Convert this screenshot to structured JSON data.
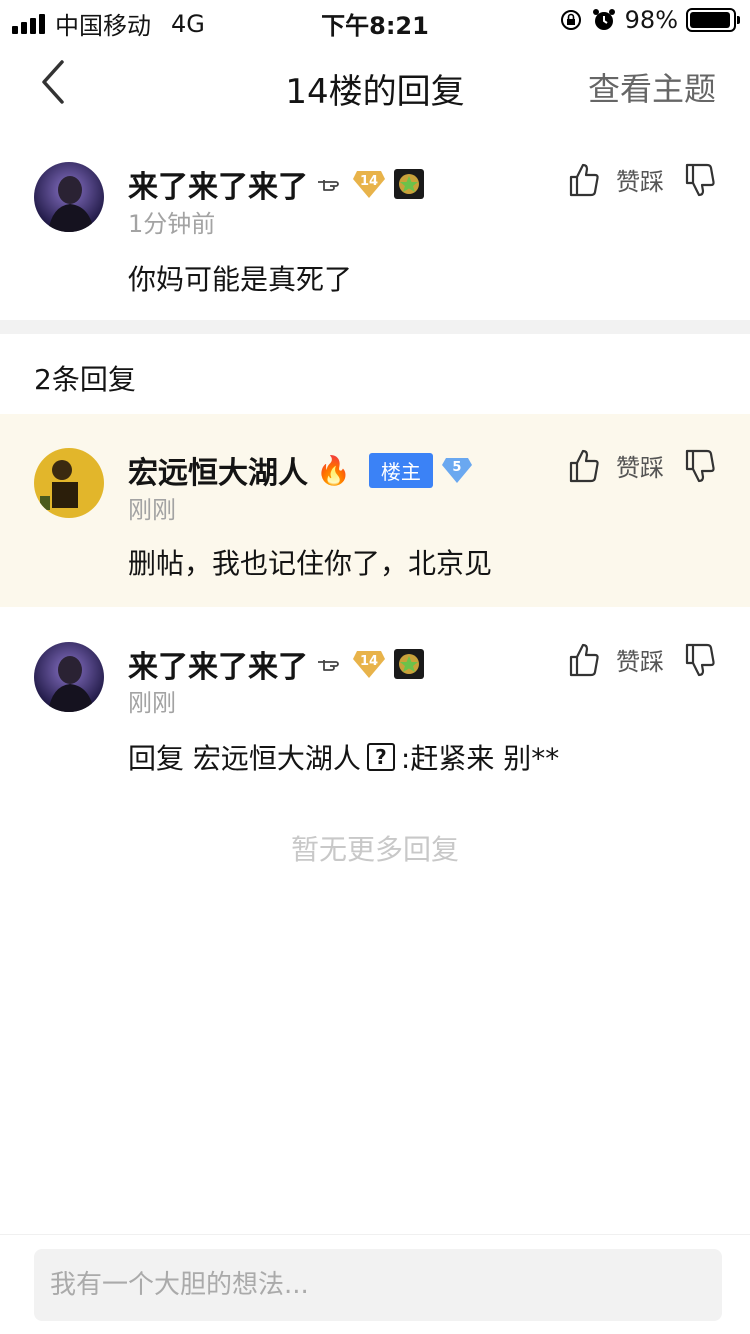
{
  "status_bar": {
    "carrier": "中国移动",
    "network": "4G",
    "time": "下午8:21",
    "battery": "98%",
    "battery_level": 0.98
  },
  "nav": {
    "title": "14楼的回复",
    "view_topic": "查看主题"
  },
  "main_post": {
    "username": "来了来了来了",
    "username_icon": "pointing-hand-icon",
    "level": "14",
    "time": "1分钟前",
    "content": "你妈可能是真死了",
    "like_icon": "thumbs-up-icon",
    "action_label": "赞踩",
    "dislike_icon": "thumbs-down-icon"
  },
  "reply_count": "2条回复",
  "replies": [
    {
      "username": "宏远恒大湖人",
      "emoji": "🔥",
      "badge": "楼主",
      "level": "5",
      "time": "刚刚",
      "content": "删帖，我也记住你了，北京见",
      "action_label": "赞踩"
    },
    {
      "username": "来了来了来了",
      "level": "14",
      "time": "刚刚",
      "content_prefix": "回复 宏远恒大湖人",
      "content_box_glyph": "?",
      "content_suffix": ":赶紧来 别**",
      "action_label": "赞踩"
    }
  ],
  "no_more": "暂无更多回复",
  "input": {
    "placeholder": "我有一个大胆的想法..."
  },
  "colors": {
    "owner_badge": "#3b82f6",
    "highlight_bg": "#fcf8ec",
    "gold_badge": "#e8b34a",
    "diamond_badge": "#6aa8f0"
  }
}
